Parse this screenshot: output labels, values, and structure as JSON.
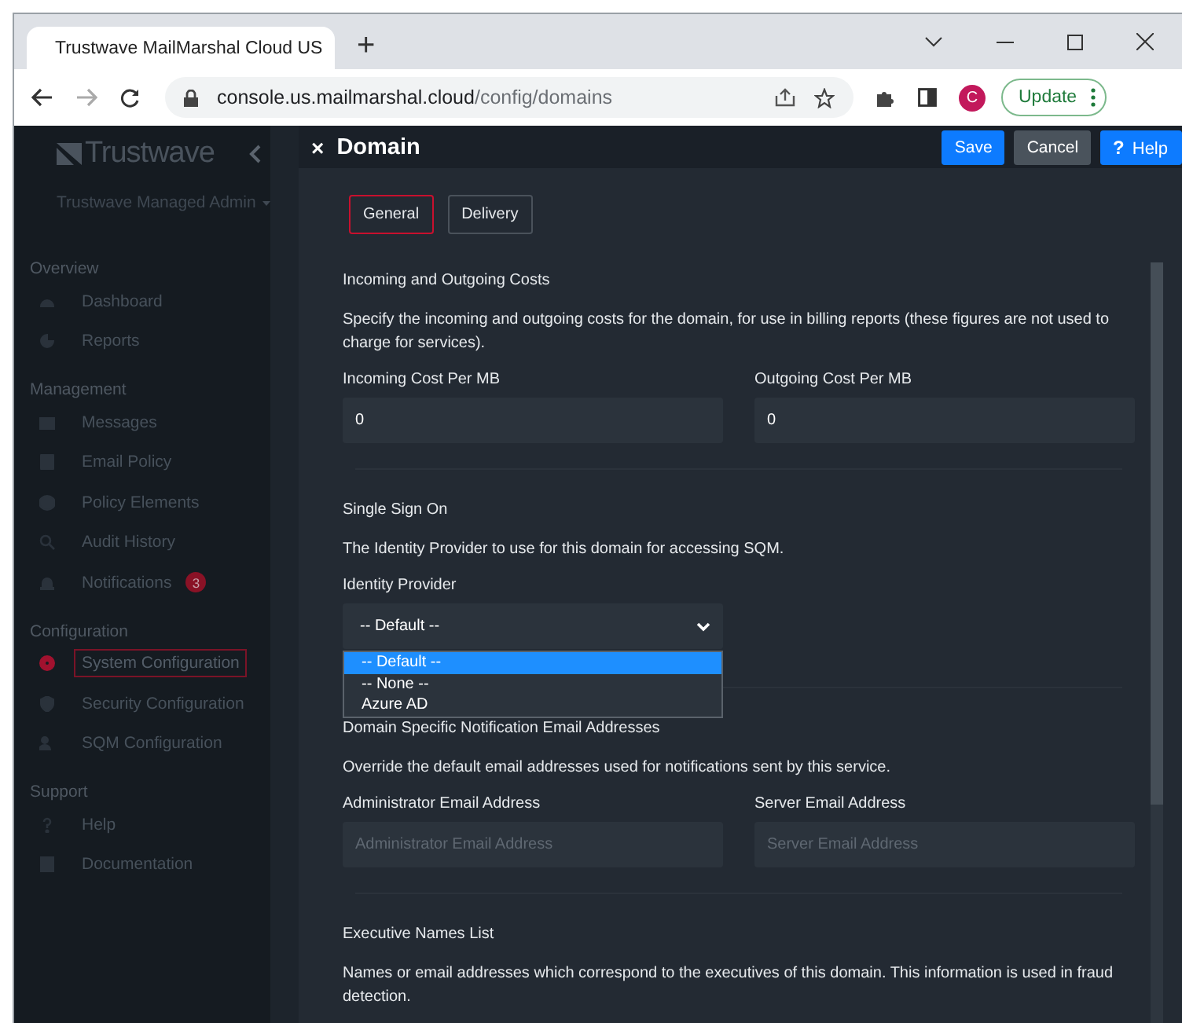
{
  "browser": {
    "tab_title": "Trustwave MailMarshal Cloud US",
    "new_tab": "+",
    "host": "console.us.mailmarshal.cloud",
    "path": "/config/domains",
    "profile_initial": "C",
    "update_button": "Update"
  },
  "sidebar": {
    "logo": "Trustwave",
    "account": "Trustwave Managed Admin",
    "sections": [
      {
        "title": "Overview",
        "items": [
          {
            "label": "Dashboard",
            "selected": false
          },
          {
            "label": "Reports",
            "selected": false
          }
        ]
      },
      {
        "title": "Management",
        "items": [
          {
            "label": "Messages",
            "selected": false
          },
          {
            "label": "Email Policy",
            "selected": false
          },
          {
            "label": "Policy Elements",
            "selected": false
          },
          {
            "label": "Audit History",
            "selected": false
          },
          {
            "label": "Notifications",
            "selected": false,
            "badge": "3"
          }
        ]
      },
      {
        "title": "Configuration",
        "items": [
          {
            "label": "System Configuration",
            "selected": true
          },
          {
            "label": "Security Configuration",
            "selected": false
          },
          {
            "label": "SQM Configuration",
            "selected": false
          }
        ]
      },
      {
        "title": "Support",
        "items": [
          {
            "label": "Help",
            "selected": false
          },
          {
            "label": "Documentation",
            "selected": false
          }
        ]
      }
    ]
  },
  "modal": {
    "close": "×",
    "title": "Domain",
    "buttons": [
      {
        "label": "Save",
        "kind": "primary"
      },
      {
        "label": "Cancel",
        "kind": "secondary"
      },
      {
        "label": "Help",
        "kind": "help",
        "icon_text": "?"
      }
    ],
    "tabs": [
      {
        "label": "General",
        "selected": true
      },
      {
        "label": "Delivery",
        "selected": false
      }
    ],
    "sections": [
      {
        "title": "Incoming and Outgoing Costs",
        "description": "Specify the incoming and outgoing costs for the domain, for use in billing reports (these figures are not used to charge for services).",
        "fields": [
          {
            "label": "Incoming Cost Per MB",
            "value": "0"
          },
          {
            "label": "Outgoing Cost Per MB",
            "value": "0"
          }
        ]
      },
      {
        "title": "Single Sign On",
        "description": "The Identity Provider to use for this domain for accessing SQM.",
        "select": {
          "label": "Identity Provider",
          "value": "-- Default --",
          "expanded": true,
          "options": [
            {
              "label": "-- Default --",
              "selected": true
            },
            {
              "label": "-- None --",
              "selected": false
            },
            {
              "label": "Azure AD",
              "selected": false
            }
          ]
        }
      },
      {
        "title": "Domain Specific Notification Email Addresses",
        "description": "Override the default email addresses used for notifications sent by this service.",
        "fields": [
          {
            "label": "Administrator Email Address",
            "placeholder": "Administrator Email Address"
          },
          {
            "label": "Server Email Address",
            "placeholder": "Server Email Address"
          }
        ]
      },
      {
        "title": "Executive Names List",
        "description": "Names or email addresses which correspond to the executives of this domain. This information is used in fraud detection."
      }
    ]
  }
}
